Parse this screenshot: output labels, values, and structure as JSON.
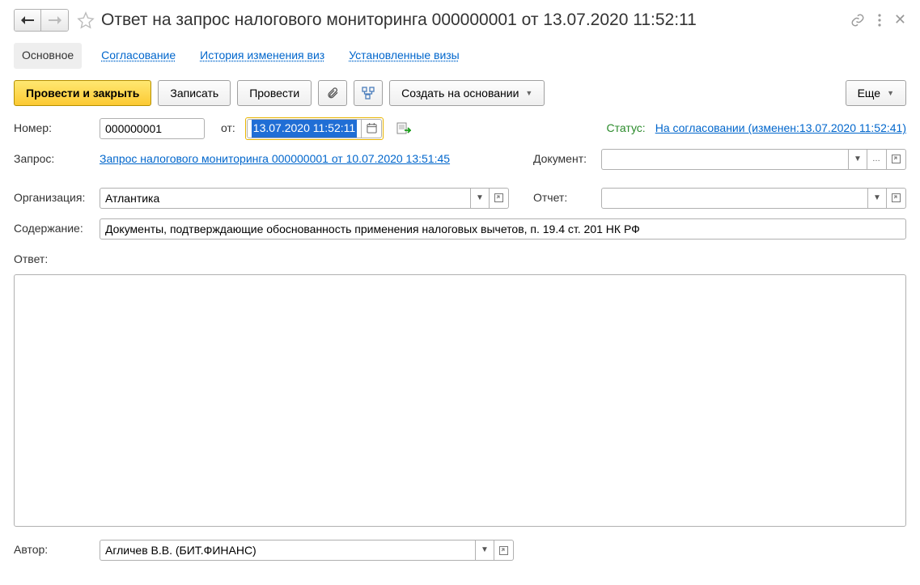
{
  "header": {
    "title": "Ответ на запрос налогового мониторинга 000000001 от 13.07.2020 11:52:11"
  },
  "tabs": {
    "main": "Основное",
    "approval": "Согласование",
    "visa_history": "История изменения виз",
    "visas_set": "Установленные визы"
  },
  "toolbar": {
    "post_close": "Провести и закрыть",
    "save": "Записать",
    "post": "Провести",
    "create_based": "Создать на основании",
    "more": "Еще"
  },
  "fields": {
    "number_label": "Номер:",
    "number_value": "000000001",
    "from_label": "от:",
    "date_value": "13.07.2020 11:52:11",
    "status_label": "Статус:",
    "status_value": "На согласовании (изменен:13.07.2020 11:52:41)",
    "request_label": "Запрос:",
    "request_link": "Запрос налогового мониторинга 000000001 от 10.07.2020 13:51:45",
    "document_label": "Документ:",
    "document_value": "",
    "org_label": "Организация:",
    "org_value": "Атлантика",
    "report_label": "Отчет:",
    "report_value": "",
    "content_label": "Содержание:",
    "content_value": "Документы, подтверждающие обоснованность применения налоговых вычетов, п. 19.4 ст. 201 НК РФ",
    "answer_label": "Ответ:",
    "answer_value": "",
    "author_label": "Автор:",
    "author_value": "Агличев В.В. (БИТ.ФИНАНС)"
  }
}
